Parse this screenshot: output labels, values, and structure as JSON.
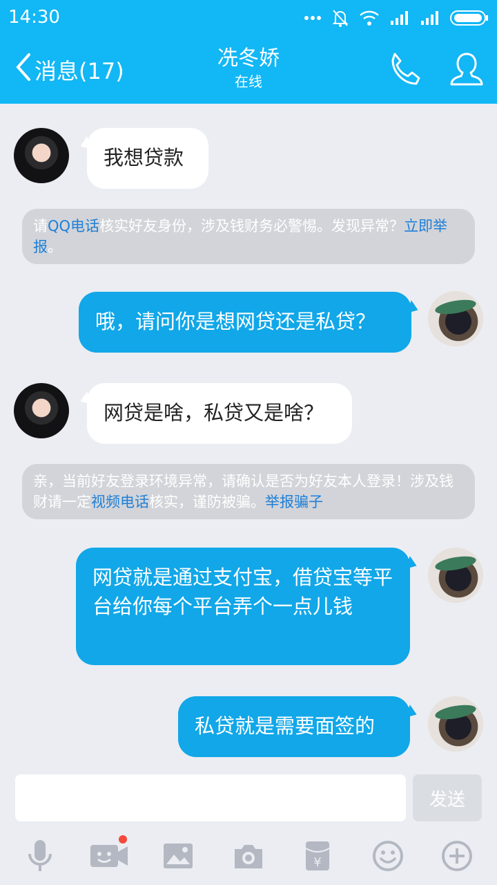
{
  "status_bar": {
    "time": "14:30"
  },
  "header": {
    "back_label": "消息(17)",
    "contact_name": "冼冬娇",
    "contact_status": "在线"
  },
  "messages": [
    {
      "side": "in",
      "text": "我想贷款"
    },
    {
      "side": "out",
      "text": "哦，请问你是想网贷还是私贷？"
    },
    {
      "side": "in",
      "text": "网贷是啥，私贷又是啥？"
    },
    {
      "side": "out",
      "text": "网贷就是通过支付宝，借贷宝等平台给你每个平台弄个一点儿钱"
    },
    {
      "side": "out",
      "text": "私贷就是需要面签的"
    }
  ],
  "notices": [
    {
      "pre": "请",
      "link1": "QQ电话",
      "mid": "核实好友身份，涉及钱财务必警惕。发现异常？",
      "link2": "立即举报",
      "post": "。"
    },
    {
      "pre": "亲，当前好友登录环境异常，请确认是否为好友本人登录！涉及钱财请一定",
      "link1": "视频电话",
      "mid": "核实，谨防被骗。",
      "link2": "举报骗子",
      "post": ""
    }
  ],
  "composer": {
    "value": "",
    "send_label": "发送"
  },
  "toolbar": {
    "items": [
      "microphone-icon",
      "video-call-icon",
      "image-icon",
      "camera-icon",
      "red-packet-icon",
      "emoji-icon",
      "plus-icon"
    ],
    "video_badge": true
  },
  "colors": {
    "header": "#12b7f5",
    "outgoing_bubble": "#11a7e8",
    "incoming_bubble": "#ffffff",
    "notice_link": "#1e7fd8",
    "background": "#ebedf2"
  }
}
